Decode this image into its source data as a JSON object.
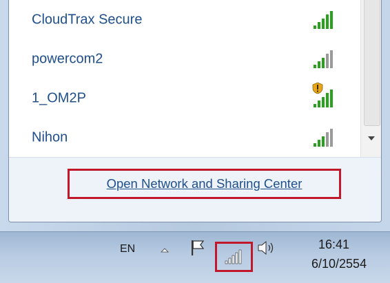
{
  "networks": [
    {
      "name": "CloudTrax Secure",
      "secured": false
    },
    {
      "name": "powercom2",
      "secured": false
    },
    {
      "name": "1_OM2P",
      "secured": true
    },
    {
      "name": "Nihon",
      "secured": false
    }
  ],
  "footer": {
    "open_link": "Open Network and Sharing Center"
  },
  "taskbar": {
    "language": "EN",
    "time": "16:41",
    "date": "6/10/2554"
  },
  "icons": {
    "signal": "wifi-signal-icon",
    "shield": "security-shield-icon",
    "chevron": "show-hidden-icons-icon",
    "flag": "action-center-flag-icon",
    "network": "network-tray-icon",
    "volume": "volume-icon"
  },
  "colors": {
    "link": "#1e4f8c",
    "highlight_box": "#c0172b",
    "signal_green": "#2aa01f"
  }
}
